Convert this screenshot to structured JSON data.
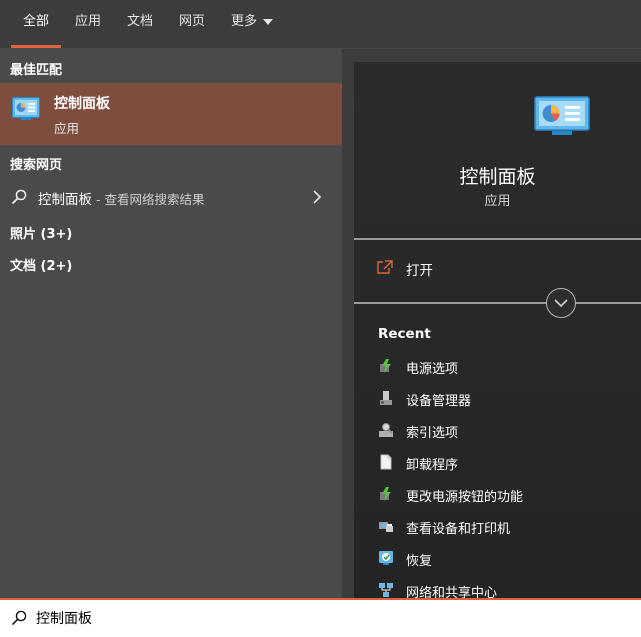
{
  "tabs": [
    {
      "label": "全部",
      "active": true
    },
    {
      "label": "应用",
      "active": false
    },
    {
      "label": "文档",
      "active": false
    },
    {
      "label": "网页",
      "active": false
    },
    {
      "label": "更多",
      "active": false
    }
  ],
  "left": {
    "best_match_header": "最佳匹配",
    "best_match": {
      "title": "控制面板",
      "subtitle": "应用",
      "icon": "control-panel-icon"
    },
    "web_header": "搜索网页",
    "web_result": {
      "query": "控制面板",
      "suffix": " - 查看网络搜索结果"
    },
    "photos_header": "照片 (3+)",
    "docs_header": "文档 (2+)"
  },
  "preview": {
    "app_name": "控制面板",
    "app_type": "应用",
    "open_label": "打开",
    "recent_header": "Recent",
    "recent_items": [
      {
        "label": "电源选项",
        "icon": "power-options-icon"
      },
      {
        "label": "设备管理器",
        "icon": "device-manager-icon"
      },
      {
        "label": "索引选项",
        "icon": "indexing-options-icon"
      },
      {
        "label": "卸载程序",
        "icon": "uninstall-program-icon"
      },
      {
        "label": "更改电源按钮的功能",
        "icon": "power-button-icon"
      },
      {
        "label": "查看设备和打印机",
        "icon": "devices-printers-icon"
      },
      {
        "label": "恢复",
        "icon": "recovery-icon"
      },
      {
        "label": "网络和共享中心",
        "icon": "network-sharing-icon"
      }
    ]
  },
  "search": {
    "value": "控制面板"
  },
  "colors": {
    "accent": "#e0623a",
    "selected_bg": "#7f4d3d",
    "left_bg": "#4a4a4a",
    "preview_bg": "#2b2b2b"
  }
}
